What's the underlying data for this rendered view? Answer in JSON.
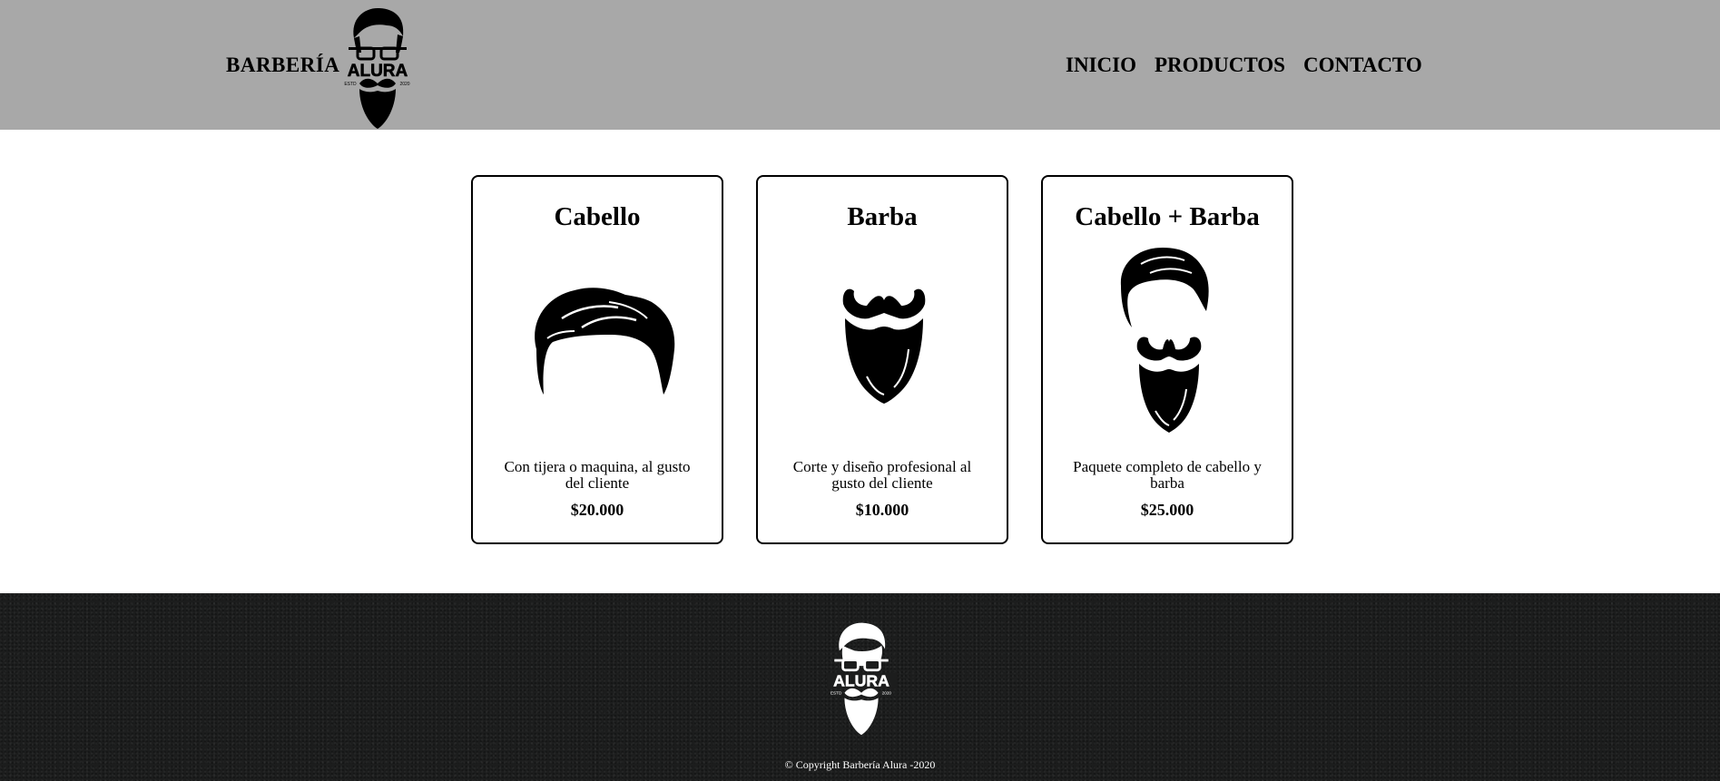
{
  "header": {
    "brand_text": "BARBERÍA",
    "logo_word": "ALURA",
    "logo_left": "ESTD",
    "logo_right": "2020",
    "nav": [
      {
        "label": "INICIO"
      },
      {
        "label": "PRODUCTOS"
      },
      {
        "label": "CONTACTO"
      }
    ]
  },
  "products": [
    {
      "title": "Cabello",
      "icon": "hair-icon",
      "description": "Con tijera o maquina, al gusto del cliente",
      "price": "$20.000"
    },
    {
      "title": "Barba",
      "icon": "beard-icon",
      "description": "Corte y diseño profesional al gusto del cliente",
      "price": "$10.000"
    },
    {
      "title": "Cabello + Barba",
      "icon": "hair-and-beard-icon",
      "description": "Paquete completo de cabello y barba",
      "price": "$25.000"
    }
  ],
  "footer": {
    "logo_word": "ALURA",
    "logo_left": "ESTD",
    "logo_right": "2020",
    "copyright": "© Copyright Barbería Alura -2020"
  },
  "colors": {
    "header_bg": "#a8a8a8",
    "footer_bg": "#1c1d1d",
    "text": "#000000"
  }
}
